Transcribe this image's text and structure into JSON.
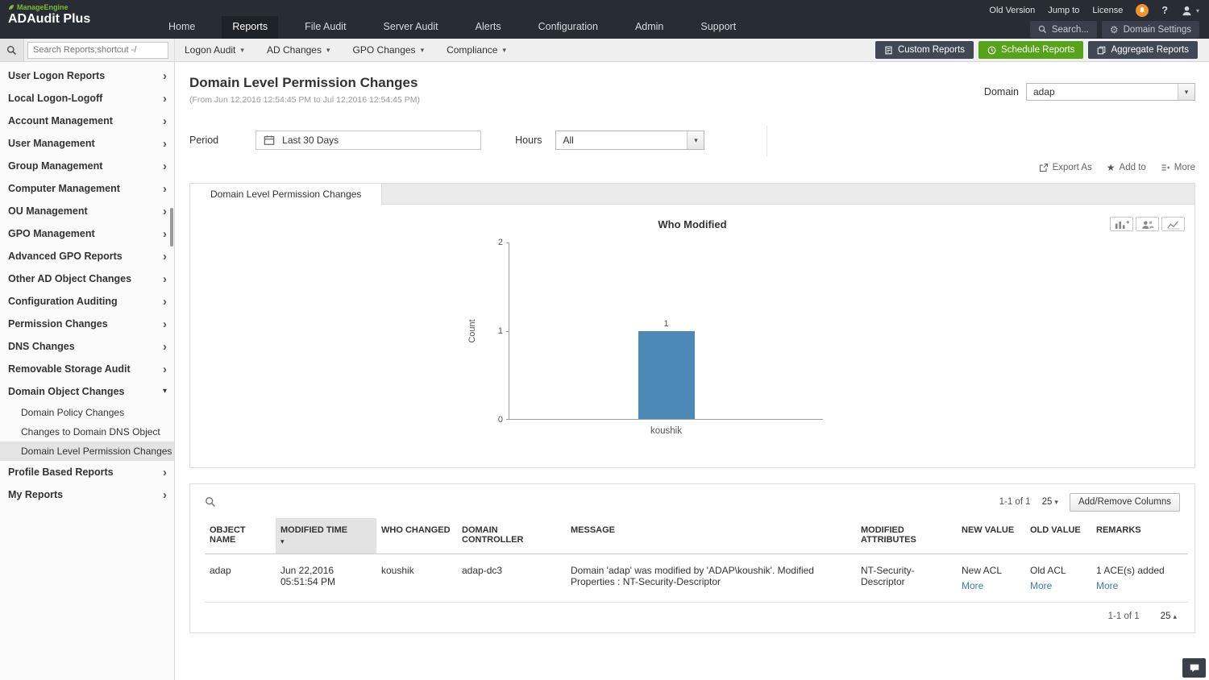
{
  "colors": {
    "topbar_bg": "#282c35",
    "brand_green": "#7cbd2a",
    "schedule_green": "#56a219",
    "dark_button": "#414855",
    "bar_fill": "#4c89b8",
    "link_blue": "#3a7dbc",
    "notification_orange": "#ef9425",
    "selected_sidebar_bg": "#e4e4e4"
  },
  "brand": {
    "company": "ManageEngine",
    "product": "ADAudit Plus"
  },
  "topbar": {
    "nav": [
      {
        "label": "Home",
        "active": false
      },
      {
        "label": "Reports",
        "active": true
      },
      {
        "label": "File Audit",
        "active": false
      },
      {
        "label": "Server Audit",
        "active": false
      },
      {
        "label": "Alerts",
        "active": false
      },
      {
        "label": "Configuration",
        "active": false
      },
      {
        "label": "Admin",
        "active": false
      },
      {
        "label": "Support",
        "active": false
      }
    ],
    "links": [
      "Old Version",
      "Jump to",
      "License"
    ],
    "search_label": "Search...",
    "domain_settings_label": "Domain Settings"
  },
  "toolbar": {
    "search_placeholder": "Search Reports;shortcut -/",
    "menus": [
      "Logon Audit",
      "AD Changes",
      "GPO Changes",
      "Compliance"
    ],
    "buttons": {
      "custom": "Custom Reports",
      "schedule": "Schedule Reports",
      "aggregate": "Aggregate Reports"
    }
  },
  "sidebar": {
    "items": [
      "User Logon Reports",
      "Local Logon-Logoff",
      "Account Management",
      "User Management",
      "Group Management",
      "Computer Management",
      "OU Management",
      "GPO Management",
      "Advanced GPO Reports",
      "Other AD Object Changes",
      "Configuration Auditing",
      "Permission Changes",
      "DNS Changes",
      "Removable Storage Audit"
    ],
    "expanded": {
      "label": "Domain Object Changes",
      "children": [
        "Domain Policy Changes",
        "Changes to Domain DNS Object",
        "Domain Level Permission Changes"
      ],
      "selected": "Domain Level Permission Changes"
    },
    "items_after": [
      "Profile Based Reports",
      "My Reports"
    ]
  },
  "report": {
    "title": "Domain Level Permission Changes",
    "date_range": "(From Jun 12,2016 12:54:45 PM to Jul 12,2016 12:54:45 PM)",
    "domain_label": "Domain",
    "domain_value": "adap",
    "period_label": "Period",
    "period_value": "Last 30 Days",
    "hours_label": "Hours",
    "hours_value": "All",
    "actions": {
      "export": "Export As",
      "add_to": "Add to",
      "more": "More"
    },
    "tab": "Domain Level Permission Changes"
  },
  "chart_data": {
    "type": "bar",
    "title": "Who Modified",
    "categories": [
      "koushik"
    ],
    "values": [
      1
    ],
    "ylabel": "Count",
    "xlabel": "",
    "ylim": [
      0,
      2
    ],
    "yticks": [
      2,
      1,
      0
    ],
    "grid": false,
    "legend": false,
    "bar_color": "#4c89b8"
  },
  "table": {
    "pagination_top": "1-1 of 1",
    "page_size": "25",
    "add_remove_columns": "Add/Remove Columns",
    "columns": [
      "OBJECT NAME",
      "MODIFIED TIME",
      "WHO CHANGED",
      "DOMAIN CONTROLLER",
      "MESSAGE",
      "MODIFIED ATTRIBUTES",
      "NEW VALUE",
      "OLD VALUE",
      "REMARKS"
    ],
    "sorted_column": "MODIFIED TIME",
    "sort_direction": "desc",
    "rows": [
      {
        "object_name": "adap",
        "modified_time": "Jun 22,2016 05:51:54 PM",
        "who_changed": "koushik",
        "domain_controller": "adap-dc3",
        "message": "Domain 'adap' was modified by 'ADAP\\koushik'. Modified Properties : NT-Security-Descriptor",
        "modified_attributes": "NT-Security-Descriptor",
        "new_value": "New ACL",
        "new_value_link": "More",
        "old_value": "Old ACL",
        "old_value_link": "More",
        "remarks": "1 ACE(s) added",
        "remarks_link": "More"
      }
    ],
    "pagination_bottom": "1-1 of 1",
    "page_size_bottom": "25"
  }
}
